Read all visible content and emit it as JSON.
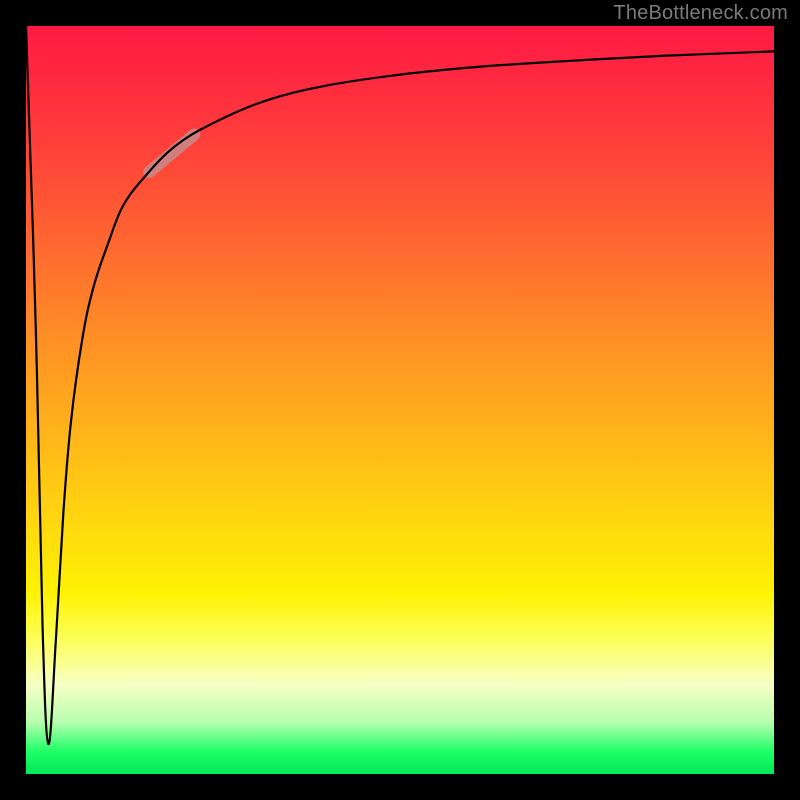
{
  "attribution": "TheBottleneck.com",
  "chart_data": {
    "type": "line",
    "title": "",
    "xlabel": "",
    "ylabel": "",
    "xlim": [
      0,
      100
    ],
    "ylim": [
      0,
      100
    ],
    "series": [
      {
        "name": "bottleneck-curve",
        "x": [
          0,
          1.3,
          2.2,
          3.0,
          4.0,
          5.0,
          6.0,
          7.5,
          9.0,
          11.0,
          13.0,
          16.0,
          20.0,
          25.0,
          32.0,
          40.0,
          50.0,
          60.0,
          72.0,
          85.0,
          100.0
        ],
        "y": [
          100,
          60,
          20,
          4,
          18,
          35,
          47,
          58,
          65,
          71,
          76,
          80,
          84,
          87,
          90,
          92,
          93.5,
          94.5,
          95.3,
          96.0,
          96.6
        ],
        "color": "#000000"
      },
      {
        "name": "highlight-segment",
        "x": [
          16.5,
          22.5
        ],
        "y": [
          80.5,
          85.5
        ],
        "color": "#c78b8b"
      }
    ],
    "background_gradient": {
      "top": "#ff1a44",
      "upper_mid": "#ff8f25",
      "mid": "#ffd60f",
      "lower_mid": "#fdff59",
      "bottom": "#00e858"
    }
  }
}
